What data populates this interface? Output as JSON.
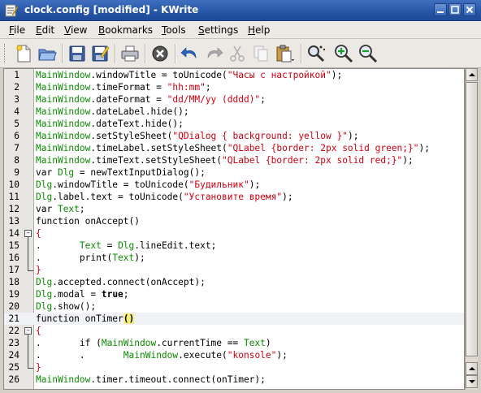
{
  "window": {
    "title": "clock.config [modified] - KWrite"
  },
  "menu": [
    {
      "label": "File",
      "key": "menu-file"
    },
    {
      "label": "Edit",
      "key": "menu-edit"
    },
    {
      "label": "View",
      "key": "menu-view"
    },
    {
      "label": "Bookmarks",
      "key": "menu-bookmarks"
    },
    {
      "label": "Tools",
      "key": "menu-tools"
    },
    {
      "label": "Settings",
      "key": "menu-settings"
    },
    {
      "label": "Help",
      "key": "menu-help"
    }
  ],
  "toolbar": {
    "icons": [
      "new-document-icon",
      "open-folder-icon",
      "save-icon",
      "save-as-icon",
      "print-icon",
      "close-document-icon",
      "undo-icon",
      "redo-icon",
      "cut-icon",
      "copy-icon",
      "paste-icon",
      "find-icon",
      "zoom-in-icon",
      "zoom-out-icon"
    ]
  },
  "editor": {
    "current_line": 21,
    "lines": [
      {
        "n": "1",
        "parts": [
          [
            "g",
            "MainWindow"
          ],
          [
            "",
            "."
          ],
          [
            "",
            "windowTitle = toUnicode("
          ],
          [
            "r",
            "\"Часы с настройкой\""
          ],
          [
            "",
            ");"
          ]
        ]
      },
      {
        "n": "2",
        "parts": [
          [
            "g",
            "MainWindow"
          ],
          [
            "",
            ".timeFormat = "
          ],
          [
            "r",
            "\"hh:mm\""
          ],
          [
            "",
            ";"
          ]
        ]
      },
      {
        "n": "3",
        "parts": [
          [
            "g",
            "MainWindow"
          ],
          [
            "",
            ".dateFormat = "
          ],
          [
            "r",
            "\"dd/MM/yy (dddd)\""
          ],
          [
            "",
            ";"
          ]
        ]
      },
      {
        "n": "4",
        "parts": [
          [
            "g",
            "MainWindow"
          ],
          [
            "",
            ".dateLabel.hide();"
          ]
        ]
      },
      {
        "n": "5",
        "parts": [
          [
            "g",
            "MainWindow"
          ],
          [
            "",
            ".dateText.hide();"
          ]
        ]
      },
      {
        "n": "6",
        "parts": [
          [
            "g",
            "MainWindow"
          ],
          [
            "",
            ".setStyleSheet("
          ],
          [
            "r",
            "\"QDialog { background: yellow }\""
          ],
          [
            "",
            ");"
          ]
        ]
      },
      {
        "n": "7",
        "parts": [
          [
            "g",
            "MainWindow"
          ],
          [
            "",
            ".timeLabel.setStyleSheet("
          ],
          [
            "r",
            "\"QLabel {border: 2px solid green;}\""
          ],
          [
            "",
            ");"
          ]
        ]
      },
      {
        "n": "8",
        "parts": [
          [
            "g",
            "MainWindow"
          ],
          [
            "",
            ".timeText.setStyleSheet("
          ],
          [
            "r",
            "\"QLabel {border: 2px solid red;}\""
          ],
          [
            "",
            ");"
          ]
        ]
      },
      {
        "n": "9",
        "parts": [
          [
            "",
            "var "
          ],
          [
            "g",
            "Dlg"
          ],
          [
            "",
            " = newTextInputDialog();"
          ]
        ]
      },
      {
        "n": "10",
        "parts": [
          [
            "g",
            "Dlg"
          ],
          [
            "",
            ".windowTitle = toUnicode("
          ],
          [
            "r",
            "\"Будильник\""
          ],
          [
            "",
            ");"
          ]
        ]
      },
      {
        "n": "11",
        "parts": [
          [
            "g",
            "Dlg"
          ],
          [
            "",
            ".label.text = toUnicode("
          ],
          [
            "r",
            "\"Установите время\""
          ],
          [
            "",
            ");"
          ]
        ]
      },
      {
        "n": "12",
        "parts": [
          [
            "",
            "var "
          ],
          [
            "g",
            "Text"
          ],
          [
            "",
            ";"
          ]
        ]
      },
      {
        "n": "13",
        "parts": [
          [
            "",
            "function onAccept()"
          ]
        ]
      },
      {
        "n": "14",
        "parts": [
          [
            "r",
            "{"
          ]
        ]
      },
      {
        "n": "15",
        "parts": [
          [
            "",
            ".       "
          ],
          [
            "g",
            "Text"
          ],
          [
            "",
            " = "
          ],
          [
            "g",
            "Dlg"
          ],
          [
            "",
            ".lineEdit.text;"
          ]
        ]
      },
      {
        "n": "16",
        "parts": [
          [
            "",
            ".       print("
          ],
          [
            "g",
            "Text"
          ],
          [
            "",
            ");"
          ]
        ]
      },
      {
        "n": "17",
        "parts": [
          [
            "r",
            "}"
          ]
        ]
      },
      {
        "n": "18",
        "parts": [
          [
            "g",
            "Dlg"
          ],
          [
            "",
            ".accepted.connect(onAccept);"
          ]
        ]
      },
      {
        "n": "19",
        "parts": [
          [
            "g",
            "Dlg"
          ],
          [
            "",
            ".modal = "
          ],
          [
            "k",
            "true"
          ],
          [
            "",
            ";"
          ]
        ]
      },
      {
        "n": "20",
        "parts": [
          [
            "g",
            "Dlg"
          ],
          [
            "",
            ".show();"
          ]
        ]
      },
      {
        "n": "21",
        "parts": [
          [
            "",
            "function onTimer"
          ],
          [
            "brk",
            "()"
          ]
        ]
      },
      {
        "n": "22",
        "parts": [
          [
            "r",
            "{"
          ]
        ]
      },
      {
        "n": "23",
        "parts": [
          [
            "",
            ".       if ("
          ],
          [
            "g",
            "MainWindow"
          ],
          [
            "",
            ".currentTime == "
          ],
          [
            "g",
            "Text"
          ],
          [
            "",
            ")"
          ]
        ]
      },
      {
        "n": "24",
        "parts": [
          [
            "",
            ".       .       "
          ],
          [
            "g",
            "MainWindow"
          ],
          [
            "",
            ".execute("
          ],
          [
            "r",
            "\"konsole\""
          ],
          [
            "",
            ");"
          ]
        ]
      },
      {
        "n": "25",
        "parts": [
          [
            "r",
            "}"
          ]
        ]
      },
      {
        "n": "26",
        "parts": [
          [
            "g",
            "MainWindow"
          ],
          [
            "",
            ".timer.timeout.connect(onTimer);"
          ]
        ]
      }
    ],
    "fold": {
      "14": "open",
      "15": "mid",
      "16": "mid",
      "17": "end",
      "22": "open",
      "23": "mid",
      "24": "mid",
      "25": "end"
    }
  }
}
